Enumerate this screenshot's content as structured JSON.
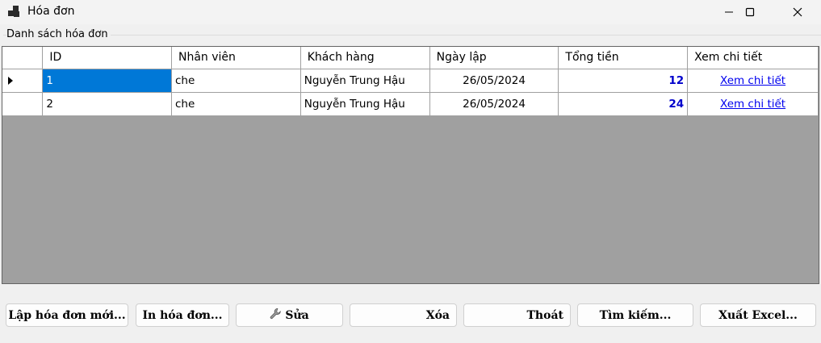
{
  "window": {
    "title": "Hóa đơn"
  },
  "group": {
    "label": "Danh sách hóa đơn"
  },
  "grid": {
    "columns": [
      "ID",
      "Nhân viên",
      "Khách hàng",
      "Ngày lập",
      "Tổng tiền",
      "Xem chi tiết"
    ],
    "rows": [
      {
        "id": "1",
        "nhan_vien": "che",
        "khach_hang": "Nguyễn Trung Hậu",
        "ngay_lap": "26/05/2024",
        "tong_tien": "12",
        "xem": "Xem chi tiết"
      },
      {
        "id": "2",
        "nhan_vien": "che",
        "khach_hang": "Nguyễn Trung Hậu",
        "ngay_lap": "26/05/2024",
        "tong_tien": "24",
        "xem": "Xem chi tiết"
      }
    ],
    "selected_row": 0
  },
  "buttons": {
    "new_invoice": "Lập hóa đơn mới...",
    "print_invoice": "In hóa đơn...",
    "edit": "Sửa",
    "delete": "Xóa",
    "exit": "Thoát",
    "search": "Tìm kiếm...",
    "export_excel": "Xuất Excel..."
  },
  "colors": {
    "selection": "#0078d7",
    "amount": "#0000cc",
    "link": "#0000ee",
    "grid_background": "#a0a0a0"
  }
}
